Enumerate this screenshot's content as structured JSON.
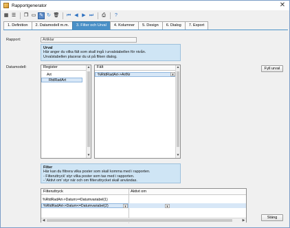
{
  "window": {
    "title": "Rapportgenerator"
  },
  "toolbar": {
    "buttons": [
      {
        "icon": "table-icon"
      },
      {
        "icon": "list-icon"
      },
      {
        "icon": "copy-icon"
      },
      {
        "icon": "folder-icon"
      },
      {
        "icon": "edit-icon"
      },
      {
        "icon": "refresh-icon"
      },
      {
        "icon": "delete-icon"
      },
      {
        "icon": "first-icon"
      },
      {
        "icon": "prev-icon"
      },
      {
        "icon": "next-icon"
      },
      {
        "icon": "last-icon"
      },
      {
        "icon": "print-icon"
      },
      {
        "icon": "help-icon"
      }
    ]
  },
  "tabs": [
    {
      "label": "1. Definition",
      "active": false
    },
    {
      "label": "2. Datamodell m.m.",
      "active": false
    },
    {
      "label": "3. Filter och Urval",
      "active": true
    },
    {
      "label": "4. Kolumner",
      "active": false
    },
    {
      "label": "5. Design",
      "active": false
    },
    {
      "label": "6. Dialog",
      "active": false
    },
    {
      "label": "7. Export",
      "active": false
    }
  ],
  "rapport": {
    "label": "Rapport:",
    "value": "Artiklar"
  },
  "urval_info": {
    "heading": "Urval",
    "line1": "Här anger du vilka fält som skall ingå i urvalstabellen för nivån.",
    "line2": "Urvalstabellen placerar du ut på fliken dialog."
  },
  "datamodell": {
    "label": "Datamodell:"
  },
  "register": {
    "header": "Register",
    "items": [
      {
        "label": "Art"
      },
      {
        "label": "RtdRadArt"
      }
    ]
  },
  "falt": {
    "header": "Fält",
    "rows": [
      {
        "value": "%RtdRadArt->ArtNr"
      }
    ]
  },
  "fyll_urval_button": "Fyll urval",
  "filter_info": {
    "heading": "Filter",
    "line1": "Här kan du filtrera vilka poster som skall komma med i rapporten.",
    "line2": "- Filteruttryck' styr vilka poster som tas med i rapporten.",
    "line3": "- 'Aktivt om' styr när och om filteruttrycket skall användas."
  },
  "filter_grid": {
    "col1": "Filteruttryck",
    "col2": "Aktivt om",
    "rows": [
      {
        "expr": "%RtdRadArt->Datum>=Datumvariabel(1)",
        "aktiv": ""
      },
      {
        "expr": "%RtdRadArt->Datum<=Datumvariabel(2)",
        "aktiv": ""
      }
    ]
  },
  "close_button": "Stäng"
}
